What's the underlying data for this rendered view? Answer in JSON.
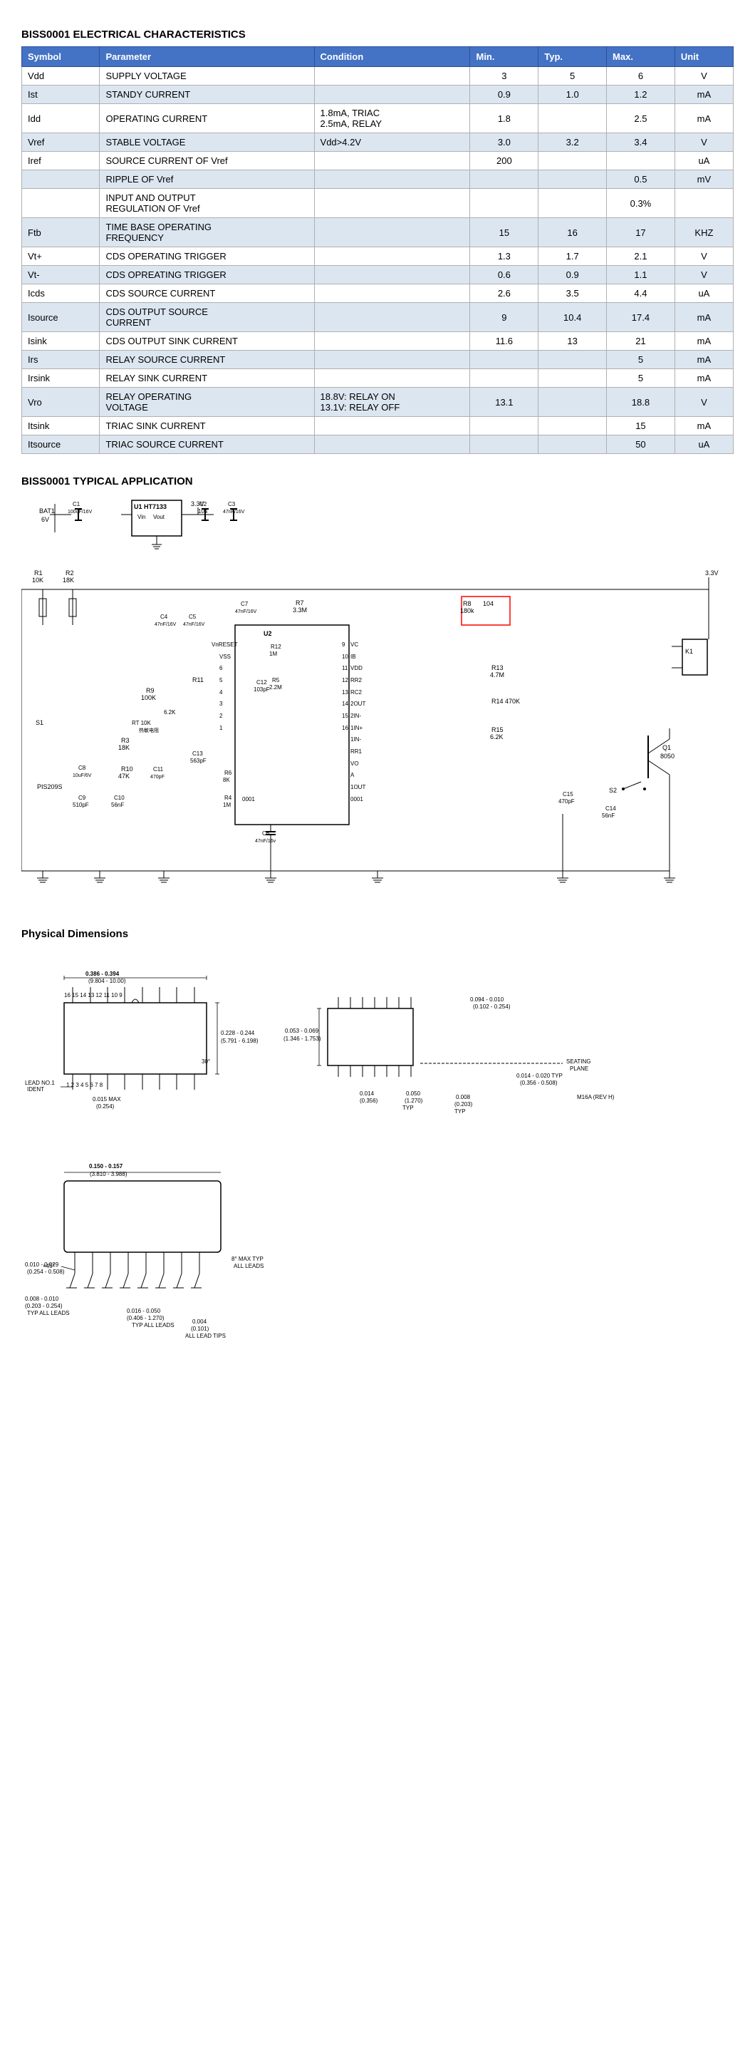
{
  "page": {
    "ec_title": "BISS0001 ELECTRICAL CHARACTERISTICS",
    "app_title": "BISS0001 TYPICAL APPLICATION",
    "phys_title": "Physical Dimensions",
    "table": {
      "headers": [
        "Symbol",
        "Parameter",
        "Condition",
        "Min.",
        "Typ.",
        "Max.",
        "Unit"
      ],
      "rows": [
        [
          "Vdd",
          "SUPPLY VOLTAGE",
          "",
          "3",
          "5",
          "6",
          "V"
        ],
        [
          "Ist",
          "STANDY CURRENT",
          "",
          "0.9",
          "1.0",
          "1.2",
          "mA"
        ],
        [
          "Idd",
          "OPERATING CURRENT",
          "1.8mA, TRIAC\n2.5mA, RELAY",
          "1.8",
          "",
          "2.5",
          "mA"
        ],
        [
          "Vref",
          "STABLE VOLTAGE",
          "Vdd>4.2V",
          "3.0",
          "3.2",
          "3.4",
          "V"
        ],
        [
          "Iref",
          "SOURCE CURRENT OF Vref",
          "",
          "200",
          "",
          "",
          "uA"
        ],
        [
          "",
          "RIPPLE OF Vref",
          "",
          "",
          "",
          "0.5",
          "mV"
        ],
        [
          "",
          "INPUT AND OUTPUT\nREGULATION OF Vref",
          "",
          "",
          "",
          "0.3%",
          ""
        ],
        [
          "Ftb",
          "TIME BASE OPERATING\nFREQUENCY",
          "",
          "15",
          "16",
          "17",
          "KHZ"
        ],
        [
          "Vt+",
          "CDS OPERATING TRIGGER",
          "",
          "1.3",
          "1.7",
          "2.1",
          "V"
        ],
        [
          "Vt-",
          "CDS OPREATING TRIGGER",
          "",
          "0.6",
          "0.9",
          "1.1",
          "V"
        ],
        [
          "Icds",
          "CDS SOURCE CURRENT",
          "",
          "2.6",
          "3.5",
          "4.4",
          "uA"
        ],
        [
          "Isource",
          "CDS OUTPUT SOURCE\nCURRENT",
          "",
          "9",
          "10.4",
          "17.4",
          "mA"
        ],
        [
          "Isink",
          "CDS OUTPUT SINK CURRENT",
          "",
          "11.6",
          "13",
          "21",
          "mA"
        ],
        [
          "Irs",
          "RELAY SOURCE CURRENT",
          "",
          "",
          "",
          "5",
          "mA"
        ],
        [
          "Irsink",
          "RELAY SINK CURRENT",
          "",
          "",
          "",
          "5",
          "mA"
        ],
        [
          "Vro",
          "RELAY OPERATING\nVOLTAGE",
          "18.8V: RELAY ON\n13.1V: RELAY OFF",
          "13.1",
          "",
          "18.8",
          "V"
        ],
        [
          "Itsink",
          "TRIAC SINK CURRENT",
          "",
          "",
          "",
          "15",
          "mA"
        ],
        [
          "Itsource",
          "TRIAC SOURCE CURRENT",
          "",
          "",
          "",
          "50",
          "uA"
        ]
      ]
    }
  }
}
